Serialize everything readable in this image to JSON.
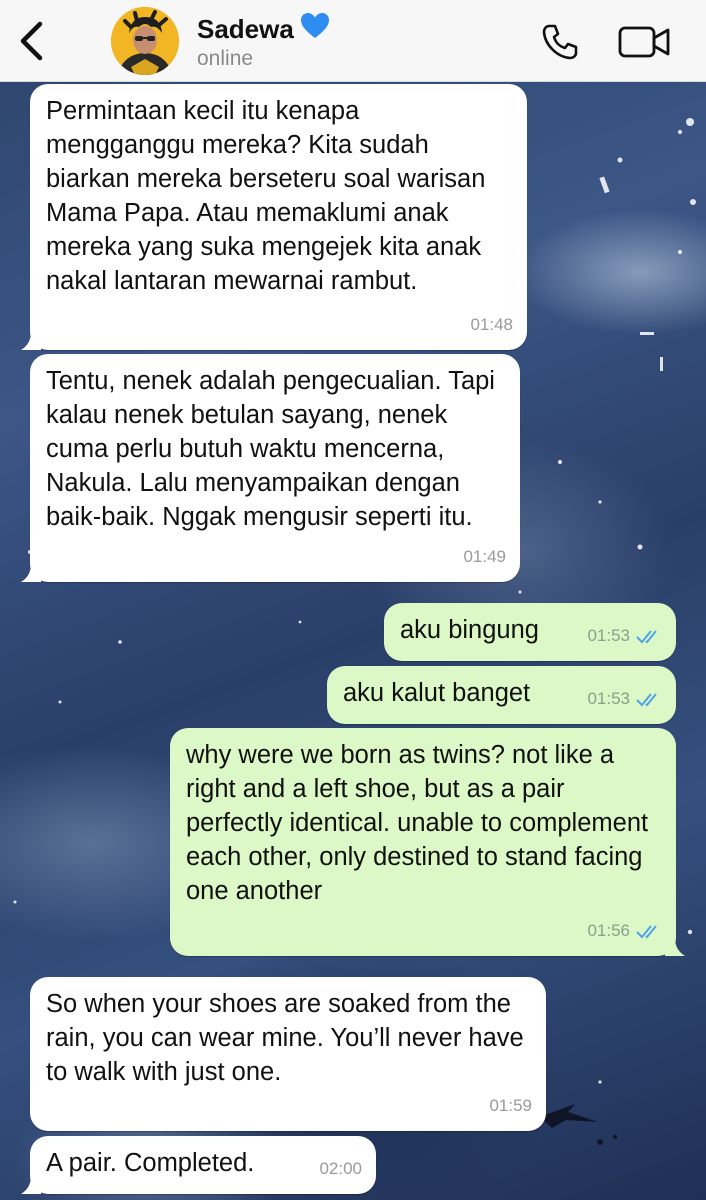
{
  "header": {
    "back_icon": "chevron-left-icon",
    "contact_name": "Sadewa",
    "name_emoji": "💙",
    "status": "online",
    "call_icon": "phone-icon",
    "video_icon": "video-camera-icon"
  },
  "messages": [
    {
      "direction": "in",
      "text": "Permintaan kecil itu kenapa mengganggu mereka? Kita sudah biarkan mereka berseteru soal warisan Mama Papa. Atau memaklumi anak mereka yang suka mengejek kita anak nakal lantaran mewarnai rambut.",
      "time": "01:48"
    },
    {
      "direction": "in",
      "text": "Tentu, nenek adalah pengecualian. Tapi kalau nenek betulan sayang, nenek cuma perlu butuh waktu mencerna, Nakula. Lalu menyampaikan dengan baik-baik. Nggak mengusir seperti itu.",
      "time": "01:49"
    },
    {
      "direction": "out",
      "text": "aku bingung",
      "time": "01:53",
      "status": "read"
    },
    {
      "direction": "out",
      "text": "aku kalut banget",
      "time": "01:53",
      "status": "read"
    },
    {
      "direction": "out",
      "text": "why were we born as twins? not like a right and a left shoe, but as a pair perfectly identical. unable to complement each other, only destined to stand facing one another",
      "time": "01:56",
      "status": "read"
    },
    {
      "direction": "in",
      "text": "So when your shoes are soaked from the rain, you can wear mine. You’ll never have to walk with just one.",
      "time": "01:59"
    },
    {
      "direction": "in",
      "text": "A pair. Completed.",
      "time": "02:00"
    }
  ],
  "colors": {
    "incoming_bubble": "#ffffff",
    "outgoing_bubble": "#dcf8c7",
    "read_ticks": "#4fa3e8",
    "accent": "#000000"
  }
}
